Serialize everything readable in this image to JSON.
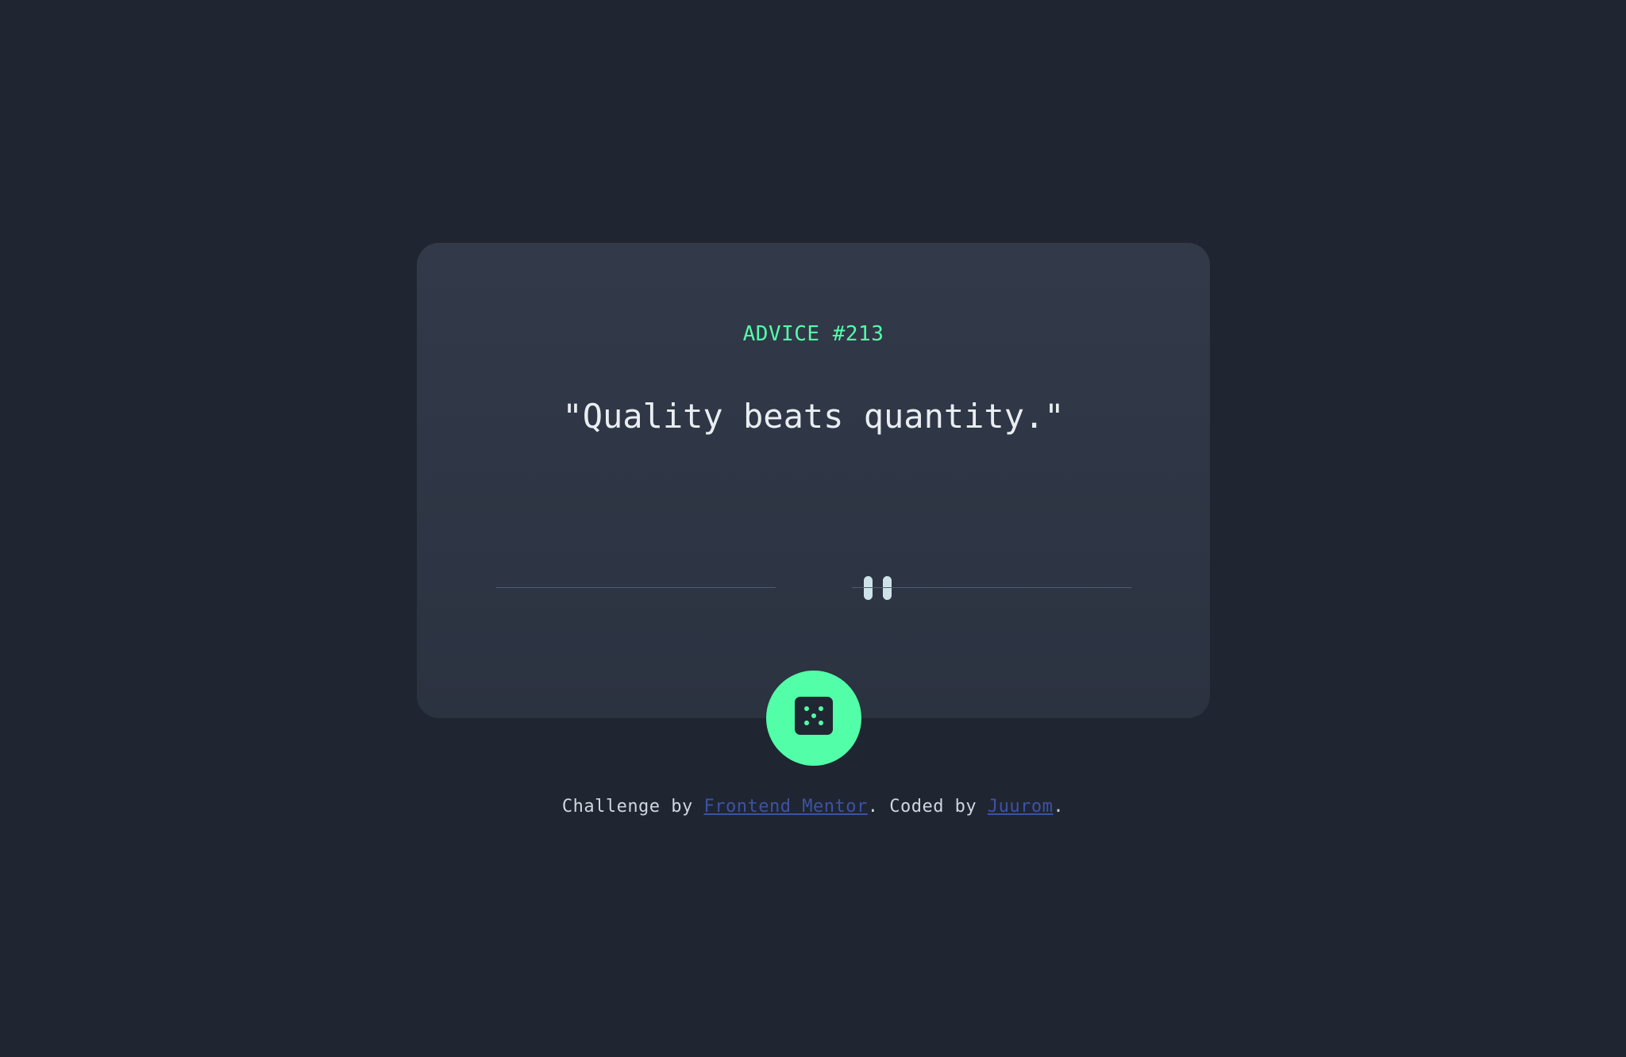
{
  "advice": {
    "id_label": "ADVICE #213",
    "text": "\"Quality beats quantity.\""
  },
  "divider": {
    "icon": "pause-icon"
  },
  "generate_button": {
    "icon": "dice-icon"
  },
  "attribution": {
    "prefix": "Challenge by ",
    "challenge_link": "Frontend Mentor",
    "middle": ". Coded by ",
    "author_link": "Juurom",
    "suffix": "."
  },
  "colors": {
    "background": "#1f2631",
    "card": "#313a49",
    "accent": "#52ffa8",
    "text": "#cee3e9",
    "link": "#3e52a3"
  }
}
